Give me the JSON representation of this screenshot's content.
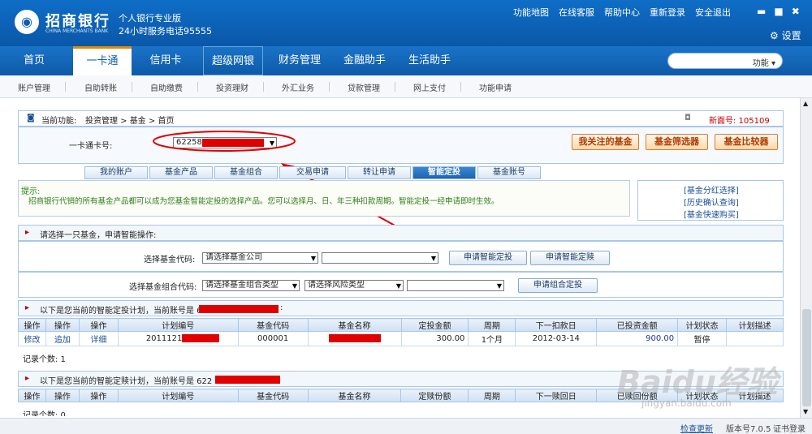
{
  "header": {
    "logo_glyph": "◉",
    "bank_name": "招商银行",
    "bank_en": "CHINA MERCHANTS BANK",
    "slogan1": "个人银行专业版",
    "slogan2": "24小时服务电话95555",
    "links": [
      "功能地图",
      "在线客服",
      "帮助中心",
      "重新登录",
      "安全退出"
    ],
    "settings": "设置"
  },
  "nav": {
    "items": [
      "首页",
      "一卡通",
      "信用卡",
      "超级网银",
      "财务管理",
      "金融助手",
      "生活助手"
    ],
    "search_placeholder": "功能"
  },
  "subnav": {
    "items": [
      "账户管理",
      "自助转账",
      "自助缴费",
      "投资理财",
      "外汇业务",
      "贷款管理",
      "网上支付",
      "功能申请"
    ]
  },
  "breadcrumb": {
    "label": "当前功能:",
    "path": "投资管理 > 基金 > 首页",
    "page_no_label": "新面号: 105109"
  },
  "card": {
    "label": "一卡通卡号:",
    "value": "62258"
  },
  "buttons": {
    "my_fund": "我关注的基金",
    "filter": "基金筛选器",
    "compare": "基金比较器"
  },
  "tabs": [
    "我的账户",
    "基金产品",
    "基金组合",
    "交易申请",
    "转让申请",
    "智能定投",
    "基金账号"
  ],
  "tip": {
    "title": "提示:",
    "text": "招商银行代销的所有基金产品都可以成为您基金智能定投的选择产品。您可以选择月、日、年三种扣款周期。智能定投一经申请即时生效。"
  },
  "side_links": [
    "[基金分红选择]",
    "[历史确认查询]",
    "[基金快速购买]"
  ],
  "apply": {
    "title": "请选择一只基金，申请智能操作:",
    "fund_code_label": "选择基金代码:",
    "fund_company": "请选择基金公司",
    "btn_apply_invest": "申请智能定投",
    "btn_apply_redeem": "申请智能定赎",
    "combo_label": "选择基金组合代码:",
    "combo_type": "请选择基金组合类型",
    "risk_type": "请选择风险类型",
    "btn_combo": "申请组合定投"
  },
  "plan": {
    "title": "以下是您当前的智能定投计划，当前账号是 6",
    "headers": [
      "操作",
      "操作",
      "操作",
      "计划编号",
      "基金代码",
      "基金名称",
      "定投金额",
      "周期",
      "下一扣款日",
      "已投资金额",
      "计划状态",
      "计划描述"
    ],
    "row": [
      "修改",
      "追加",
      "详细",
      "2011121",
      "000001",
      "",
      "300.00",
      "1个月",
      "2012-03-14",
      "900.00",
      "暂停",
      ""
    ],
    "count": "记录个数: 1"
  },
  "redeem": {
    "title": "以下是您当前的智能定赎计划，当前账号是 622",
    "headers": [
      "操作",
      "操作",
      "操作",
      "计划编号",
      "基金代码",
      "基金名称",
      "定赎份额",
      "周期",
      "下一赎回日",
      "已赎回份额",
      "计划状态",
      "计划描述"
    ],
    "count": "记录个数: 0"
  },
  "status": {
    "update": "检查更新",
    "version": "版本号7.0.5",
    "cert": "证书登录"
  },
  "watermark": {
    "main": "Baidu经验",
    "url": "jingyan.baidu.com"
  }
}
